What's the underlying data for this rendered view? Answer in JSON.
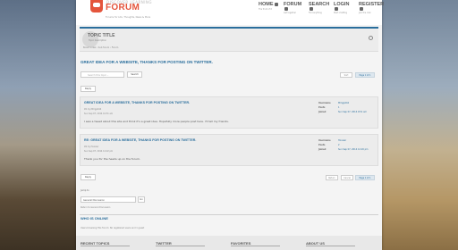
{
  "header": {
    "logo_tagline_top": "DISCOVER LEARNING",
    "logo_text": "FORUM",
    "logo_sub": "Forums for Life, Thoughts, News & More",
    "nav": [
      {
        "label": "HOME",
        "sub": "The front of it"
      },
      {
        "label": "FORUM",
        "sub": "Get together"
      },
      {
        "label": "SEARCH",
        "sub": "Find anything"
      },
      {
        "label": "LOGIN",
        "sub": "Start chatting"
      },
      {
        "label": "REGISTER",
        "sub": "Join the club"
      }
    ]
  },
  "title_box": {
    "title": "TOPIC TITLE",
    "desc": "Topic description",
    "crumb": "Board index ‹ Sub forum ‹ Forum"
  },
  "topic": {
    "title": "GREAT IDEA FOR A WEBSITE, THANKS FOR POSTING ON TWITTER.",
    "search_placeholder": "Search this topic…",
    "search_btn": "Search",
    "toolbar_btn": "Sort",
    "page_label": "Page 1 of 1",
    "reply_label": "Reply"
  },
  "posts": [
    {
      "title": "GREAT IDEA FOR A WEBSITE, THANKS FOR POSTING ON TWITTER.",
      "meta1": "#1 by Mmgp444",
      "meta2": "Sun Sep 07, 2014 10:51 am",
      "body": "I saw a tweet about this site and think it's a great idea. Hopefully more people post here. I'll tell my friends.",
      "author": {
        "k1": "Username",
        "v1": "Mmgp444",
        "k2": "Posts",
        "v2": "1",
        "k3": "Joined",
        "v3": "Sun Sep 07, 2014 9:51 am"
      }
    },
    {
      "title": "RE: GREAT IDEA FOR A WEBSITE, THANKS FOR POSTING ON TWITTER.",
      "meta1": "#2 by Hoosier",
      "meta2": "Sun Sep 07, 2014 12:22 pm",
      "body": "Thank you for the heads up on the forum.",
      "author": {
        "k1": "Username",
        "v1": "Hoosier",
        "k2": "Posts",
        "v2": "2",
        "k3": "Joined",
        "v3": "Sun Sep 07, 2014 12:20 pm"
      }
    }
  ],
  "bottom_bar": {
    "btn1": "Return",
    "btn2": "Cancel",
    "page_label": "Page 1 of 1"
  },
  "jumpto": {
    "label": "Jump to",
    "selected": "General Discussion",
    "go": "Go",
    "return_link": "Return to General Discussion"
  },
  "who": {
    "title": "WHO IS ONLINE",
    "text": "Users browsing this forum: No registered users and 1 guest"
  },
  "footer": {
    "cols": [
      "RECENT TOPICS",
      "TWITTER",
      "FAVORITES",
      "ABOUT US"
    ]
  },
  "colors": {
    "accent": "#2a6e9c",
    "brand": "#e4553c"
  }
}
